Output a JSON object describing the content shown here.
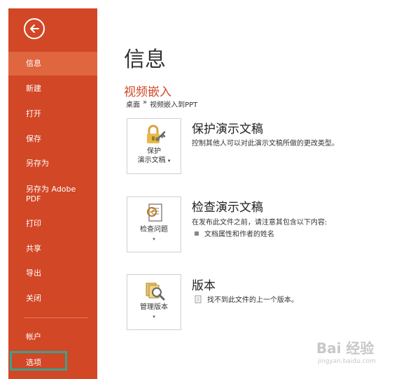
{
  "sidebar": {
    "items": [
      {
        "label": "信息",
        "active": true
      },
      {
        "label": "新建"
      },
      {
        "label": "打开"
      },
      {
        "label": "保存"
      },
      {
        "label": "另存为"
      },
      {
        "label": "另存为 Adobe PDF"
      },
      {
        "label": "打印"
      },
      {
        "label": "共享"
      },
      {
        "label": "导出"
      },
      {
        "label": "关闭"
      },
      {
        "label": "帐户"
      },
      {
        "label": "选项"
      }
    ],
    "back_icon": "back-arrow-icon",
    "accent_color": "#d24726",
    "highlight_color": "#3aa28c"
  },
  "main": {
    "title": "信息",
    "doc_title": "视频嵌入",
    "breadcrumb": [
      "桌面",
      "»",
      "视频嵌入到PPT"
    ],
    "sections": [
      {
        "card_label_line1": "保护",
        "card_label_line2": "演示文稿",
        "caret": "▾",
        "icon": "lock-key-icon",
        "title": "保护演示文稿",
        "desc": "控制其他人可以对此演示文稿所做的更改类型。"
      },
      {
        "card_label_line1": "检查问题",
        "caret": "▾",
        "icon": "inspect-document-icon",
        "title": "检查演示文稿",
        "desc": "在发布此文件之前，请注意其包含以下内容:",
        "bullets": [
          "文档属性和作者的姓名"
        ]
      },
      {
        "card_label_line1": "管理版本",
        "caret": "▾",
        "icon": "manage-versions-icon",
        "title": "版本",
        "bullets": [
          "找不到此文件的上一个版本。"
        ]
      }
    ]
  },
  "watermark": {
    "text": "Bai 经验",
    "url": "jingyan.baidu.com"
  }
}
